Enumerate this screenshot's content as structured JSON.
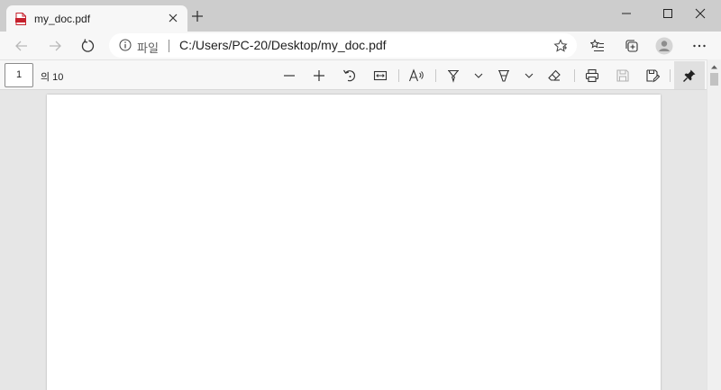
{
  "tab": {
    "title": "my_doc.pdf",
    "favicon": "pdf-file-icon"
  },
  "address": {
    "scheme_label": "파일",
    "url": "C:/Users/PC-20/Desktop/my_doc.pdf"
  },
  "pdf_toolbar": {
    "page_number": "1",
    "page_total": "의 10",
    "tools": [
      "zoom-out-icon",
      "zoom-in-icon",
      "rotate-icon",
      "fit-page-icon",
      "read-aloud-icon",
      "draw-icon",
      "highlight-icon",
      "erase-icon",
      "print-icon",
      "save-icon",
      "save-as-icon",
      "pin-icon"
    ]
  },
  "colors": {
    "titlebar": "#cdcdcd",
    "toolbar": "#f7f7f7",
    "viewport": "#e6e6e6",
    "page": "#ffffff",
    "pdf_red": "#c5202c"
  }
}
